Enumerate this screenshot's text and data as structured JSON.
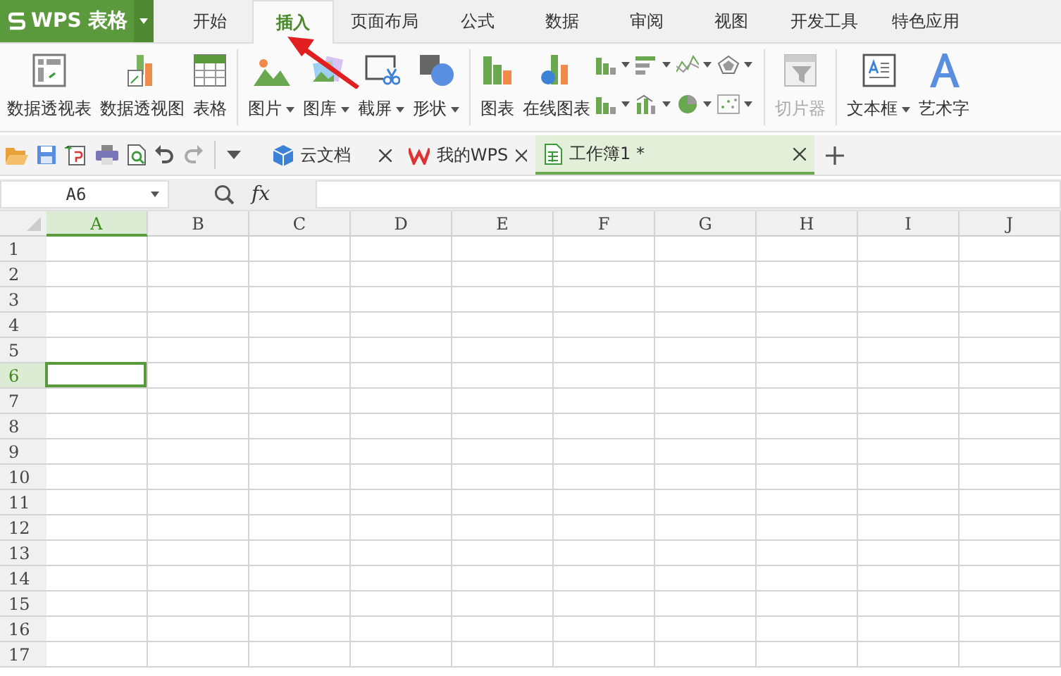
{
  "app_menu": {
    "label": "WPS 表格"
  },
  "menu_tabs": [
    {
      "label": "开始",
      "selected": false
    },
    {
      "label": "插入",
      "selected": true
    },
    {
      "label": "页面布局",
      "selected": false
    },
    {
      "label": "公式",
      "selected": false
    },
    {
      "label": "数据",
      "selected": false
    },
    {
      "label": "审阅",
      "selected": false
    },
    {
      "label": "视图",
      "selected": false
    },
    {
      "label": "开发工具",
      "selected": false
    },
    {
      "label": "特色应用",
      "selected": false
    }
  ],
  "ribbon_groups": [
    {
      "items": [
        {
          "kind": "large",
          "label": "数据透视表",
          "dropdown": false,
          "disabled": false
        },
        {
          "kind": "large",
          "label": "数据透视图",
          "dropdown": false,
          "disabled": false
        },
        {
          "kind": "large",
          "label": "表格",
          "dropdown": false,
          "disabled": false
        }
      ]
    },
    {
      "items": [
        {
          "kind": "large",
          "label": "图片",
          "dropdown": true,
          "disabled": false
        },
        {
          "kind": "large",
          "label": "图库",
          "dropdown": true,
          "disabled": false
        },
        {
          "kind": "large",
          "label": "截屏",
          "dropdown": true,
          "disabled": false
        },
        {
          "kind": "large",
          "label": "形状",
          "dropdown": true,
          "disabled": false
        }
      ]
    },
    {
      "items": [
        {
          "kind": "large",
          "label": "图表",
          "dropdown": false,
          "disabled": false
        },
        {
          "kind": "large",
          "label": "在线图表",
          "dropdown": false,
          "disabled": false
        },
        {
          "kind": "small_grid"
        }
      ]
    },
    {
      "items": [
        {
          "kind": "large",
          "label": "切片器",
          "dropdown": false,
          "disabled": true
        }
      ]
    },
    {
      "items": [
        {
          "kind": "large",
          "label": "文本框",
          "dropdown": true,
          "disabled": false
        },
        {
          "kind": "large",
          "label": "艺术字",
          "dropdown": false,
          "disabled": false
        }
      ]
    }
  ],
  "doc_tabs": [
    {
      "label": "云文档",
      "selected": false
    },
    {
      "label": "我的WPS",
      "selected": false
    },
    {
      "label": "工作簿1 *",
      "selected": true
    }
  ],
  "name_box": {
    "value": "A6"
  },
  "formula_bar": {
    "fx_label": "fx"
  },
  "sheet": {
    "columns": [
      {
        "label": "A",
        "selected": true
      },
      {
        "label": "B",
        "selected": false
      },
      {
        "label": "C",
        "selected": false
      },
      {
        "label": "D",
        "selected": false
      },
      {
        "label": "E",
        "selected": false
      },
      {
        "label": "F",
        "selected": false
      },
      {
        "label": "G",
        "selected": false
      },
      {
        "label": "H",
        "selected": false
      },
      {
        "label": "I",
        "selected": false
      },
      {
        "label": "J",
        "selected": false
      }
    ],
    "rows": [
      {
        "label": "1",
        "selected": false
      },
      {
        "label": "2",
        "selected": false
      },
      {
        "label": "3",
        "selected": false
      },
      {
        "label": "4",
        "selected": false
      },
      {
        "label": "5",
        "selected": false
      },
      {
        "label": "6",
        "selected": true
      },
      {
        "label": "7",
        "selected": false
      },
      {
        "label": "8",
        "selected": false
      },
      {
        "label": "9",
        "selected": false
      },
      {
        "label": "10",
        "selected": false
      },
      {
        "label": "11",
        "selected": false
      },
      {
        "label": "12",
        "selected": false
      },
      {
        "label": "13",
        "selected": false
      },
      {
        "label": "14",
        "selected": false
      },
      {
        "label": "15",
        "selected": false
      },
      {
        "label": "16",
        "selected": false
      },
      {
        "label": "17",
        "selected": false
      }
    ]
  }
}
